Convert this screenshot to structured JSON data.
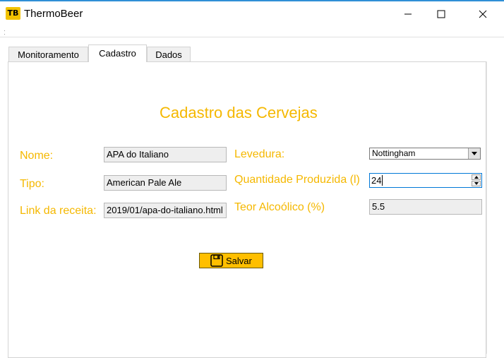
{
  "window": {
    "title": "ThermoBeer",
    "icon_text": "TB",
    "icon_color": "#f2c200"
  },
  "tabs": [
    {
      "label": "Monitoramento",
      "active": false
    },
    {
      "label": "Cadastro",
      "active": true
    },
    {
      "label": "Dados",
      "active": false
    }
  ],
  "form": {
    "heading": "Cadastro das Cervejas",
    "nome_label": "Nome:",
    "nome_value": "APA do Italiano",
    "tipo_label": "Tipo:",
    "tipo_value": "American Pale Ale",
    "link_label": "Link da receita:",
    "link_value": "2019/01/apa-do-italiano.html",
    "levedura_label": "Levedura:",
    "levedura_value": "Nottingham",
    "quantidade_label": "Quantidade Produzida (l)",
    "quantidade_value": "24",
    "teor_label": "Teor Alcoólico (%)",
    "teor_value": "5.5",
    "save_label": "Salvar"
  },
  "colors": {
    "label": "#f5b800",
    "button": "#ffbf00",
    "accent": "#0078d7"
  },
  "icons": {
    "app": "thermobeer-logo-icon",
    "minimize": "minimize-icon",
    "maximize": "maximize-icon",
    "close": "close-icon",
    "save": "floppy-disk-icon",
    "dropdown": "chevron-down-icon",
    "spin_up": "spin-up-icon",
    "spin_down": "spin-down-icon"
  }
}
